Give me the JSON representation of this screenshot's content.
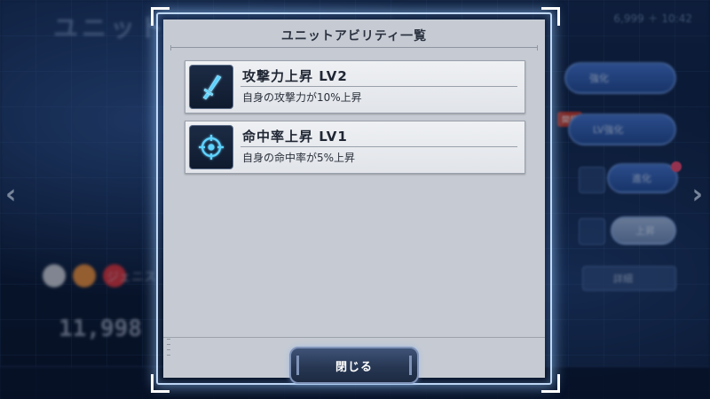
{
  "background": {
    "screen_title": "ユニット",
    "top_right_status": "6,999 ＋    10:42",
    "pill_buttons": [
      "強化",
      "LV強化",
      "進化"
    ],
    "new_badge": "開発",
    "sort_label": "上昇",
    "search_label": "詳細",
    "character_name": "ジェニス",
    "score": "11,998",
    "nav_left": "‹",
    "nav_right": "›"
  },
  "dialog": {
    "title": "ユニットアビリティ一覧",
    "abilities": [
      {
        "name": "攻撃力上昇 LV2",
        "description": "自身の攻撃力が10%上昇",
        "icon": "sword-icon"
      },
      {
        "name": "命中率上昇 LV1",
        "description": "自身の命中率が5%上昇",
        "icon": "crosshair-icon"
      }
    ],
    "close_label": "閉じる"
  },
  "colors": {
    "dialog_bg": "#c6cbd3",
    "icon_glow": "#5fd3ff",
    "button_bg": "#273753"
  }
}
